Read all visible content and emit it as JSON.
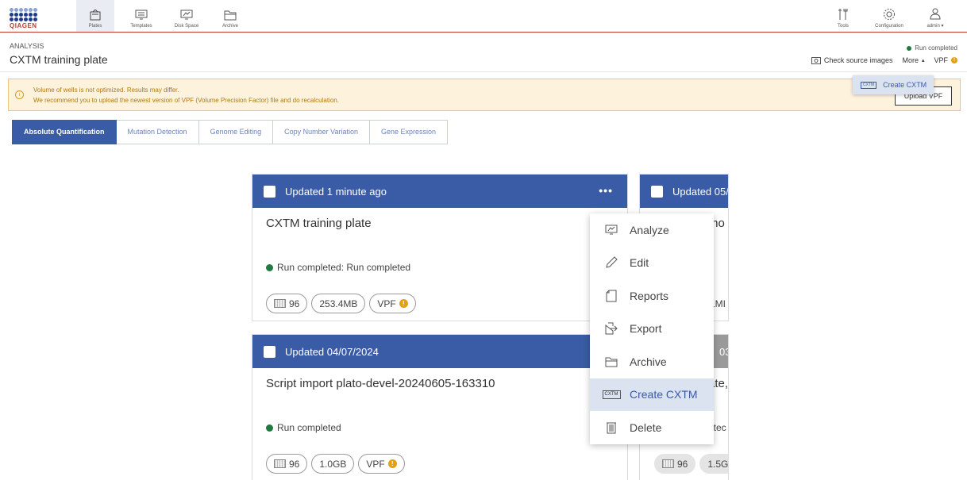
{
  "nav": {
    "brand": "QIAGEN",
    "left_items": [
      {
        "label": "Plates",
        "icon": "plates-icon"
      },
      {
        "label": "Templates",
        "icon": "templates-icon"
      },
      {
        "label": "Disk Space",
        "icon": "disk-space-icon"
      },
      {
        "label": "Archive",
        "icon": "archive-icon"
      }
    ],
    "right_items": [
      {
        "label": "Tools",
        "icon": "tools-icon"
      },
      {
        "label": "Configuration",
        "icon": "gear-icon"
      },
      {
        "label": "admin",
        "icon": "user-icon"
      }
    ],
    "user_caret": "▾"
  },
  "header": {
    "section": "ANALYSIS",
    "title": "CXTM training plate",
    "status": "Run completed",
    "check_source": "Check source images",
    "more": "More",
    "more_caret": "▴",
    "vpf": "VPF"
  },
  "banner": {
    "line1": "Volume of wells is not optimized. Results may differ.",
    "line2": "We recommend you to upload the newest version of VPF (Volume Precision Factor) file and do recalculation.",
    "upload_button": "Upload VPF"
  },
  "more_menu": {
    "item_badge": "CXTM",
    "item_label": "Create CXTM"
  },
  "tabs": [
    {
      "label": "Absolute Quantification",
      "active": true
    },
    {
      "label": "Mutation Detection",
      "active": false
    },
    {
      "label": "Genome Editing",
      "active": false
    },
    {
      "label": "Copy Number Variation",
      "active": false
    },
    {
      "label": "Gene Expression",
      "active": false
    }
  ],
  "cards": [
    {
      "updated": "Updated 1 minute ago",
      "name": "CXTM training plate",
      "status": "Run completed: Run completed",
      "wells": "96",
      "size": "253.4MB",
      "vpf": "VPF",
      "menu": "•••"
    },
    {
      "updated": "Updated 04/07/2024",
      "name": "Script import plato-devel-20240605-163310",
      "status": "Run completed",
      "wells": "96",
      "size": "1.0GB",
      "vpf": "VPF"
    }
  ],
  "right_cards": [
    {
      "updated": "Updated 05/",
      "name": "mo",
      "size": "1MI"
    },
    {
      "updated": "03/",
      "name": "ate,",
      "status": "etec",
      "wells": "96",
      "size": "1.5G"
    }
  ],
  "context_menu": [
    {
      "label": "Analyze",
      "icon": "analyze-icon"
    },
    {
      "label": "Edit",
      "icon": "pencil-icon"
    },
    {
      "label": "Reports",
      "icon": "reports-icon"
    },
    {
      "label": "Export",
      "icon": "export-icon"
    },
    {
      "label": "Archive",
      "icon": "folder-icon"
    },
    {
      "label": "Create CXTM",
      "icon": "cxtm-icon",
      "badge": "CXTM"
    },
    {
      "label": "Delete",
      "icon": "trash-icon"
    }
  ],
  "colors": {
    "primary": "#3a5ba5",
    "brand_red": "#c0392b",
    "status_green": "#1f7a3f",
    "warning": "#e5a00d",
    "banner_bg": "#fdf2dc"
  }
}
